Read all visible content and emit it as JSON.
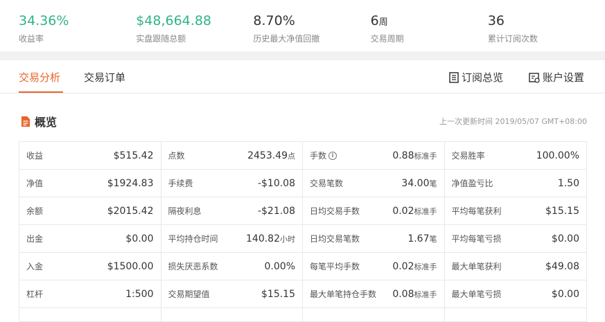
{
  "stats": [
    {
      "value": "34.36%",
      "unit": "",
      "label": "收益率",
      "green": true
    },
    {
      "value": "$48,664.88",
      "unit": "",
      "label": "实盘跟随总额",
      "green": true
    },
    {
      "value": "8.70%",
      "unit": "",
      "label": "历史最大净值回撤",
      "green": false
    },
    {
      "value": "6",
      "unit": "周",
      "label": "交易周期",
      "green": false
    },
    {
      "value": "36",
      "unit": "",
      "label": "累计订阅次数",
      "green": false
    }
  ],
  "tabs": {
    "analysis": "交易分析",
    "orders": "交易订单"
  },
  "links": {
    "subscription": "订阅总览",
    "account": "账户设置"
  },
  "overview": {
    "title": "概览",
    "updated": "上一次更新时间 2019/05/07 GMT+08:00"
  },
  "rows": [
    [
      {
        "label": "收益",
        "value": "$515.42",
        "unit": ""
      },
      {
        "label": "点数",
        "value": "2453.49",
        "unit": "点"
      },
      {
        "label": "手数",
        "value": "0.88",
        "unit": "标准手",
        "info": true
      },
      {
        "label": "交易胜率",
        "value": "100.00%",
        "unit": ""
      }
    ],
    [
      {
        "label": "净值",
        "value": "$1924.83",
        "unit": ""
      },
      {
        "label": "手续费",
        "value": "-$10.08",
        "unit": ""
      },
      {
        "label": "交易笔数",
        "value": "34.00",
        "unit": "笔"
      },
      {
        "label": "净值盈亏比",
        "value": "1.50",
        "unit": ""
      }
    ],
    [
      {
        "label": "余额",
        "value": "$2015.42",
        "unit": ""
      },
      {
        "label": "隔夜利息",
        "value": "-$21.08",
        "unit": ""
      },
      {
        "label": "日均交易手数",
        "value": "0.02",
        "unit": "标准手"
      },
      {
        "label": "平均每笔获利",
        "value": "$15.15",
        "unit": ""
      }
    ],
    [
      {
        "label": "出金",
        "value": "$0.00",
        "unit": ""
      },
      {
        "label": "平均持仓时间",
        "value": "140.82",
        "unit": "小时"
      },
      {
        "label": "日均交易笔数",
        "value": "1.67",
        "unit": "笔"
      },
      {
        "label": "平均每笔亏损",
        "value": "$0.00",
        "unit": ""
      }
    ],
    [
      {
        "label": "入金",
        "value": "$1500.00",
        "unit": ""
      },
      {
        "label": "损失厌恶系数",
        "value": "0.00%",
        "unit": ""
      },
      {
        "label": "每笔平均手数",
        "value": "0.02",
        "unit": "标准手"
      },
      {
        "label": "最大单笔获利",
        "value": "$49.08",
        "unit": ""
      }
    ],
    [
      {
        "label": "杠杆",
        "value": "1:500",
        "unit": ""
      },
      {
        "label": "交易期望值",
        "value": "$15.15",
        "unit": ""
      },
      {
        "label": "最大单笔持仓手数",
        "value": "0.08",
        "unit": "标准手"
      },
      {
        "label": "最大单笔亏损",
        "value": "$0.00",
        "unit": ""
      }
    ]
  ]
}
